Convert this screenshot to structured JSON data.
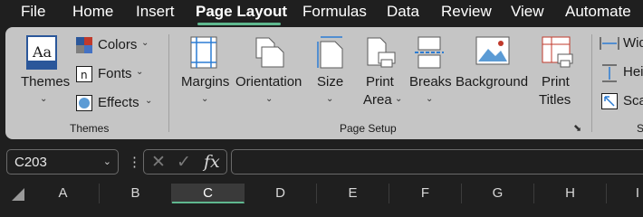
{
  "tabs": [
    "File",
    "Home",
    "Insert",
    "Page Layout",
    "Formulas",
    "Data",
    "Review",
    "View",
    "Automate"
  ],
  "active_tab": "Page Layout",
  "ribbon": {
    "themes_group": {
      "themes_label": "Themes",
      "colors_label": "Colors",
      "fonts_label": "Fonts",
      "effects_label": "Effects",
      "group_label": "Themes"
    },
    "page_setup_group": {
      "margins_label": "Margins",
      "orientation_label": "Orientation",
      "size_label": "Size",
      "print_area_line1": "Print",
      "print_area_line2": "Area",
      "breaks_label": "Breaks",
      "background_label": "Background",
      "print_titles_line1": "Print",
      "print_titles_line2": "Titles",
      "group_label": "Page Setup"
    },
    "scale_group": {
      "width_label": "Wid",
      "height_label": "Hei",
      "scale_label": "Sca",
      "group_label": "S"
    }
  },
  "formula_bar": {
    "name_box": "C203",
    "formula": "",
    "fx_label": "fx"
  },
  "columns": [
    "A",
    "B",
    "C",
    "D",
    "E",
    "F",
    "G",
    "H",
    "I"
  ],
  "active_column": "C",
  "colors": {
    "accent": "#5fb88f",
    "ribbon_bg": "#c5c5c5",
    "window_bg": "#1f1f1f"
  }
}
